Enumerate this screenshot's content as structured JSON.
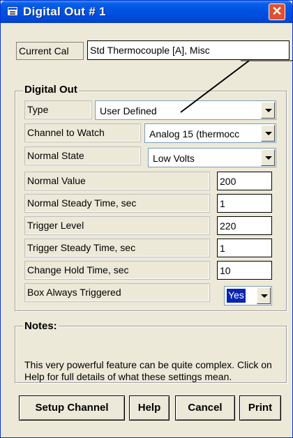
{
  "window": {
    "title": "Digital Out # 1",
    "close_glyph": "✕"
  },
  "current_cal": {
    "label": "Current Cal",
    "value": "Std Thermocouple [A], Misc"
  },
  "digital_out": {
    "legend": "Digital Out",
    "type": {
      "label": "Type",
      "value": "User Defined"
    },
    "channel": {
      "label": "Channel to Watch",
      "value": "Analog 15 (thermocc"
    },
    "normal_state": {
      "label": "Normal State",
      "value": "Low Volts"
    },
    "normal_value": {
      "label": "Normal Value",
      "value": "200"
    },
    "normal_steady": {
      "label": "Normal Steady Time, sec",
      "value": "1"
    },
    "trigger_level": {
      "label": "Trigger Level",
      "value": "220"
    },
    "trigger_steady": {
      "label": "Trigger Steady Time, sec",
      "value": "1"
    },
    "change_hold": {
      "label": "Change Hold Time, sec",
      "value": "10"
    },
    "always_triggered": {
      "label": "Box Always Triggered",
      "value": "Yes"
    }
  },
  "notes": {
    "legend": "Notes:",
    "text": "This very powerful feature can be quite complex. Click on Help for full details of what these settings mean."
  },
  "buttons": {
    "setup": "Setup Channel",
    "help": "Help",
    "cancel": "Cancel",
    "print": "Print"
  },
  "colors": {
    "titlebar": "#0054e3",
    "dialog_face": "#ece9d8",
    "close_button": "#e0512f",
    "selection": "#0a24b3"
  },
  "icons": [
    "window-icon",
    "close-icon",
    "dropdown-arrow-icon"
  ]
}
